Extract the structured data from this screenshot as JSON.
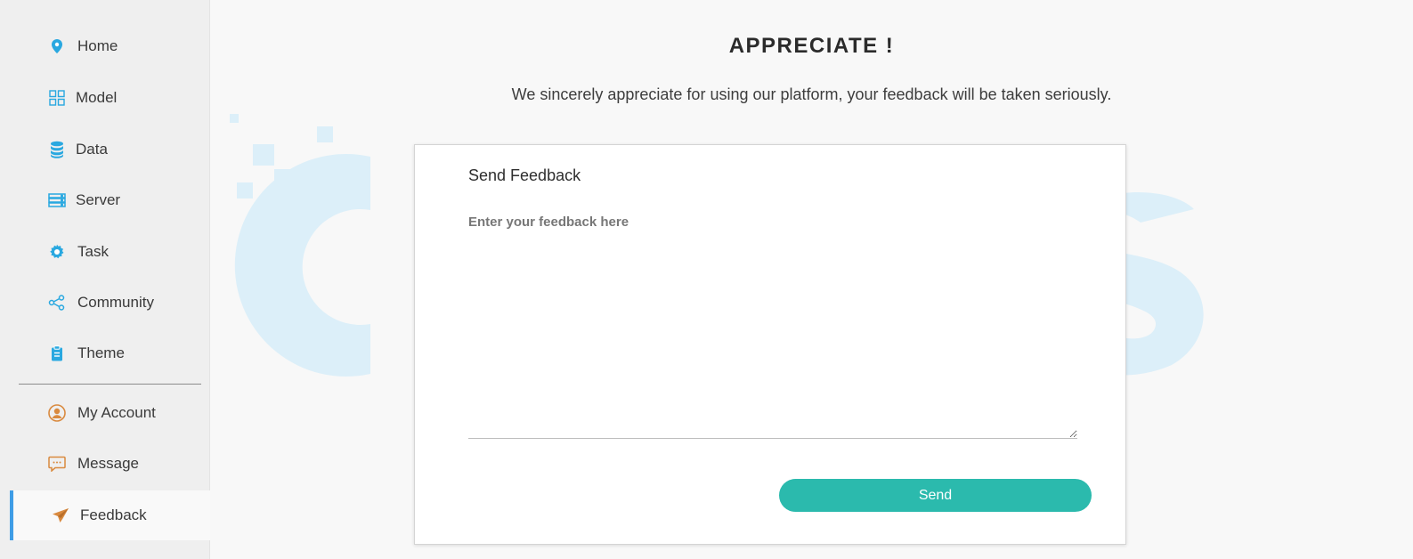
{
  "sidebar": {
    "items": [
      {
        "label": "Home",
        "icon": "map-pin-icon"
      },
      {
        "label": "Model",
        "icon": "grid-icon"
      },
      {
        "label": "Data",
        "icon": "database-icon"
      },
      {
        "label": "Server",
        "icon": "server-icon"
      },
      {
        "label": "Task",
        "icon": "gear-icon"
      },
      {
        "label": "Community",
        "icon": "share-icon"
      },
      {
        "label": "Theme",
        "icon": "clipboard-icon"
      }
    ],
    "account_items": [
      {
        "label": "My Account",
        "icon": "user-circle-icon"
      },
      {
        "label": "Message",
        "icon": "chat-icon"
      },
      {
        "label": "Feedback",
        "icon": "paper-plane-icon",
        "active": true
      }
    ]
  },
  "main": {
    "title": "APPRECIATE !",
    "subtitle": "We sincerely appreciate for using our platform, your feedback will be taken seriously."
  },
  "feedback_card": {
    "title": "Send Feedback",
    "input_placeholder": "Enter your feedback here",
    "input_value": "",
    "send_label": "Send"
  },
  "colors": {
    "accent_blue": "#29a8e0",
    "accent_orange": "#d98a3f",
    "send_button": "#2bbaad",
    "active_indicator": "#3f9de6",
    "watermark": "#dceff9"
  }
}
